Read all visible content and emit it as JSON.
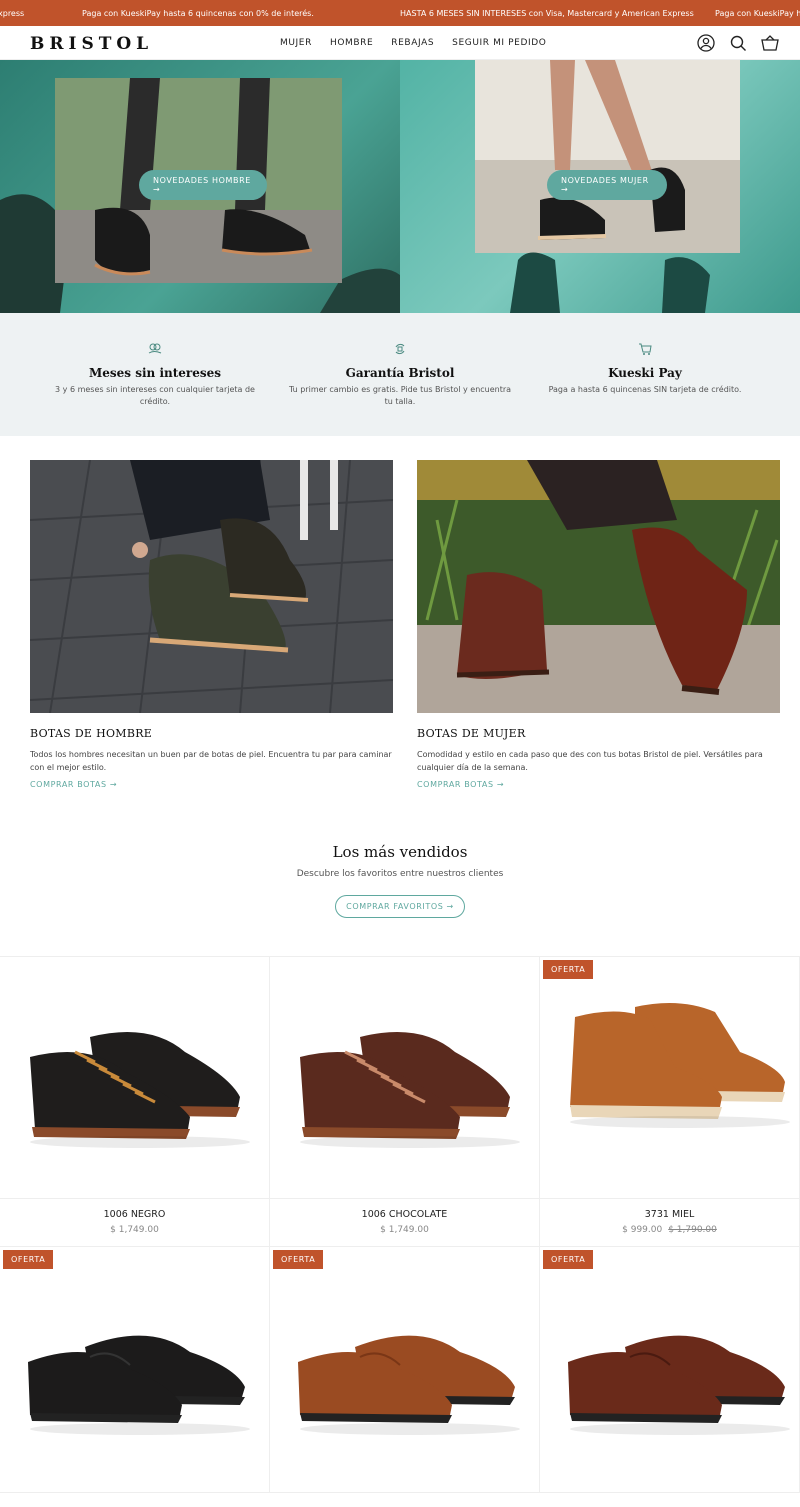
{
  "announcement": {
    "left_fragment": "xpress",
    "msg_kueski": "Paga con KueskiPay hasta 6 quincenas con 0% de interés.",
    "msg_msi": "HASTA 6 MESES SIN INTERESES con Visa, Mastercard y American Express",
    "msg_kueski_repeat": "Paga con KueskiPay h"
  },
  "header": {
    "logo": "BRISTOL",
    "menu": [
      "MUJER",
      "HOMBRE",
      "REBAJAS",
      "SEGUIR MI PEDIDO"
    ],
    "icons": [
      "account-icon",
      "search-icon",
      "cart-icon"
    ]
  },
  "hero": {
    "btn_men": "NOVEDADES HOMBRE →",
    "btn_women": "NOVEDADES MUJER →"
  },
  "benefits": [
    {
      "icon": "hand-coins-icon",
      "title": "Meses sin intereses",
      "text": "3 y 6 meses sin intereses con cualquier tarjeta de crédito."
    },
    {
      "icon": "exchange-icon",
      "title": "Garantía Bristol",
      "text": "Tu primer cambio es gratis. Pide tus Bristol y encuentra tu talla."
    },
    {
      "icon": "cart-icon",
      "title": "Kueski Pay",
      "text": "Paga a hasta 6 quincenas SIN tarjeta de crédito."
    }
  ],
  "categories": [
    {
      "title": "BOTAS DE HOMBRE",
      "text": "Todos los hombres necesitan un buen par de botas de piel. Encuentra tu par para caminar con el mejor estilo.",
      "link": "COMPRAR BOTAS →"
    },
    {
      "title": "BOTAS DE MUJER",
      "text": "Comodidad y estilo en cada paso que des con tus botas Bristol de piel. Versátiles para cualquier día de la semana.",
      "link": "COMPRAR BOTAS →"
    }
  ],
  "best_sellers": {
    "title": "Los más vendidos",
    "subtitle": "Descubre los favoritos entre nuestros clientes",
    "button": "COMPRAR FAVORITOS →"
  },
  "products": [
    {
      "name": "1006 NEGRO",
      "price": "$ 1,749.00",
      "old_price": "",
      "badge": "",
      "color": "#1f1d1c",
      "accent": "#c98a3a"
    },
    {
      "name": "1006 CHOCOLATE",
      "price": "$ 1,749.00",
      "old_price": "",
      "badge": "",
      "color": "#5a2a1e",
      "accent": "#c98a6a"
    },
    {
      "name": "3731 MIEL",
      "price": "$ 999.00",
      "old_price": "$ 1,790.00",
      "badge": "OFERTA",
      "color": "#b8652a",
      "accent": "#e9d6b8"
    },
    {
      "name": "",
      "price": "",
      "old_price": "",
      "badge": "OFERTA",
      "color": "#1c1b1b",
      "accent": "#333333"
    },
    {
      "name": "",
      "price": "",
      "old_price": "",
      "badge": "OFERTA",
      "color": "#9a4b22",
      "accent": "#7a3616"
    },
    {
      "name": "",
      "price": "",
      "old_price": "",
      "badge": "OFERTA",
      "color": "#6a2a1a",
      "accent": "#4a1a10"
    }
  ],
  "colors": {
    "brand": "#c0532b",
    "teal": "#5fa89f"
  }
}
